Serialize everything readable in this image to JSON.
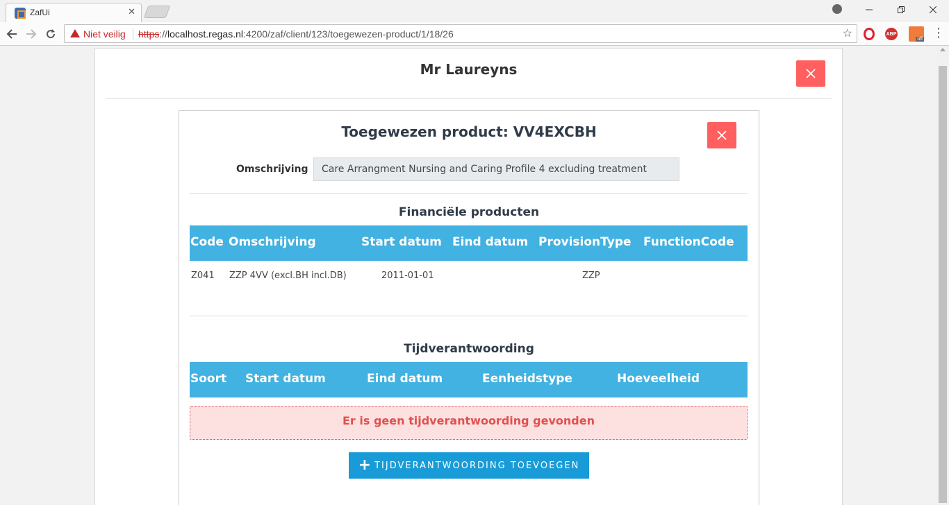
{
  "browser": {
    "tab_title": "ZafUi",
    "tab_close": "✕",
    "security_text": "Niet veilig",
    "url_scheme": "https",
    "url_sep": "://",
    "url_host": "localhost.regas.nl",
    "url_path": ":4200/zaf/client/123/toegewezen-product/1/18/26",
    "ext_abp": "ABP",
    "ext_off": "off"
  },
  "page": {
    "client_name": "Mr Laureyns",
    "product_title": "Toegewezen product: VV4EXCBH",
    "omschrijving_label": "Omschrijving",
    "omschrijving_value": "Care Arrangment Nursing and Caring Profile 4 excluding treatment"
  },
  "financial": {
    "title": "Financiële producten",
    "headers": [
      "Code",
      "Omschrijving",
      "Start datum",
      "Eind datum",
      "ProvisionType",
      "FunctionCode"
    ],
    "rows": [
      {
        "code": "Z041",
        "omschrijving": "ZZP 4VV (excl.BH incl.DB)",
        "start_datum": "2011-01-01",
        "eind_datum": "",
        "provision_type": "ZZP",
        "function_code": ""
      }
    ]
  },
  "time": {
    "title": "Tijdverantwoording",
    "headers": [
      "Soort",
      "Start datum",
      "Eind datum",
      "Eenheidstype",
      "Hoeveelheid"
    ],
    "empty_message": "Er is geen tijdverantwoording gevonden",
    "add_button_plus": "+",
    "add_button_label": "TIJDVERANTWOORDING TOEVOEGEN"
  },
  "colors": {
    "table_header": "#41b2e1",
    "close_button": "#ff5f5f",
    "primary_button": "#189bd7",
    "alert_text": "#e0514f"
  }
}
